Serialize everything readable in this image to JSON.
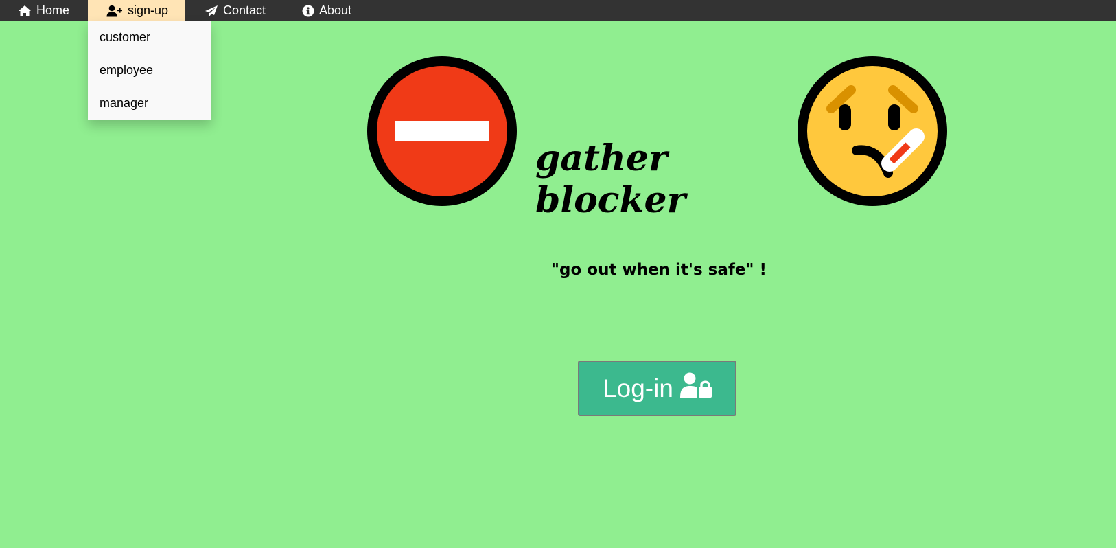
{
  "nav": {
    "items": [
      {
        "label": "Home",
        "icon": "home-icon"
      },
      {
        "label": "sign-up",
        "icon": "user-plus-icon"
      },
      {
        "label": "Contact",
        "icon": "paper-plane-icon"
      },
      {
        "label": "About",
        "icon": "info-circle-icon"
      }
    ],
    "active": "sign-up"
  },
  "signup_dropdown": {
    "items": [
      "customer",
      "employee",
      "manager"
    ]
  },
  "hero": {
    "title": "gather blocker",
    "tagline": "\"go out when it's safe\" !",
    "left_emoji": "no-entry-icon",
    "right_emoji": "face-with-thermometer-icon"
  },
  "login_button": {
    "label": "Log-in",
    "icon": "user-lock-icon"
  },
  "colors": {
    "background": "#90ee90",
    "navbar": "#333333",
    "active_nav": "#ffe4b5",
    "dropdown": "#f9f9f9",
    "login_button": "#3cb98e",
    "no_entry_red": "#f03a17",
    "emoji_yellow": "#ffc83d",
    "eyebrow": "#d99100"
  }
}
